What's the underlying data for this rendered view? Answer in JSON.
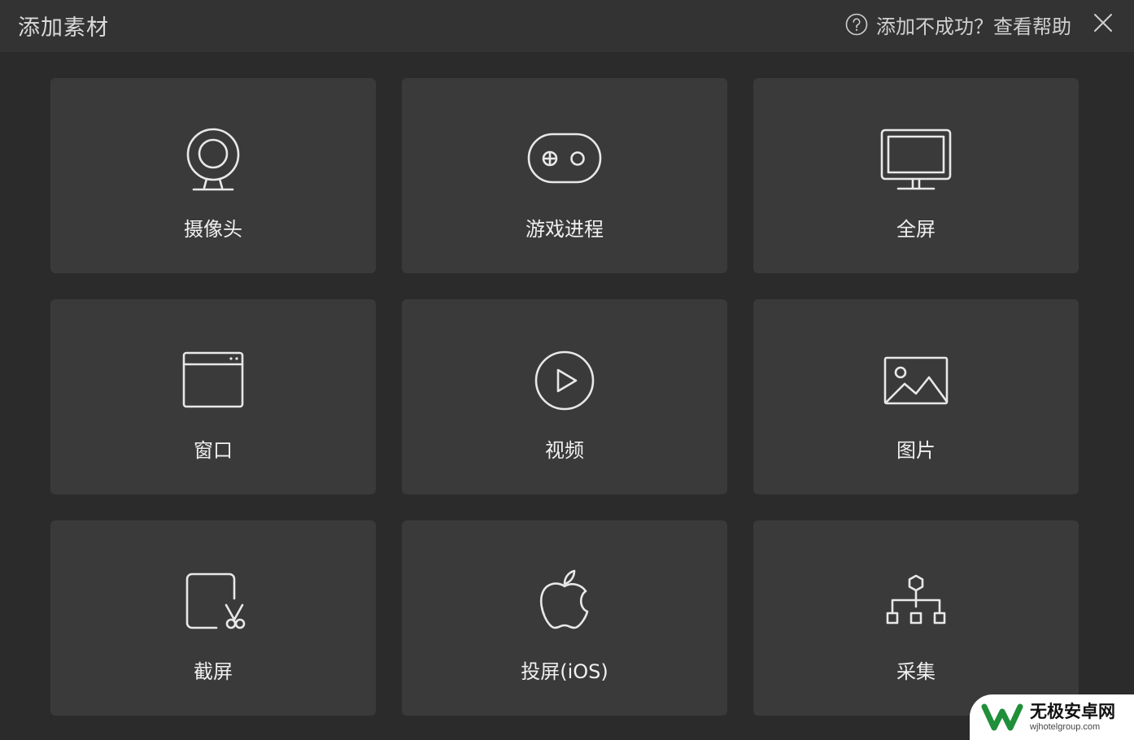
{
  "dialog": {
    "title": "添加素材",
    "help_text": "添加不成功？查看帮助"
  },
  "tiles": [
    {
      "label": "摄像头",
      "icon": "webcam-icon"
    },
    {
      "label": "游戏进程",
      "icon": "gamepad-icon"
    },
    {
      "label": "全屏",
      "icon": "monitor-icon"
    },
    {
      "label": "窗口",
      "icon": "window-icon"
    },
    {
      "label": "视频",
      "icon": "play-circle-icon"
    },
    {
      "label": "图片",
      "icon": "image-icon"
    },
    {
      "label": "截屏",
      "icon": "screenshot-scissors-icon"
    },
    {
      "label": "投屏(iOS)",
      "icon": "apple-icon"
    },
    {
      "label": "采集",
      "icon": "hierarchy-icon"
    }
  ],
  "watermark": {
    "main": "无极安卓网",
    "sub": "wjhotelgroup.com"
  },
  "colors": {
    "background": "#2b2b2b",
    "titlebar": "#333333",
    "tile": "#3a3a3a",
    "icon_stroke": "#e8e8e8"
  }
}
